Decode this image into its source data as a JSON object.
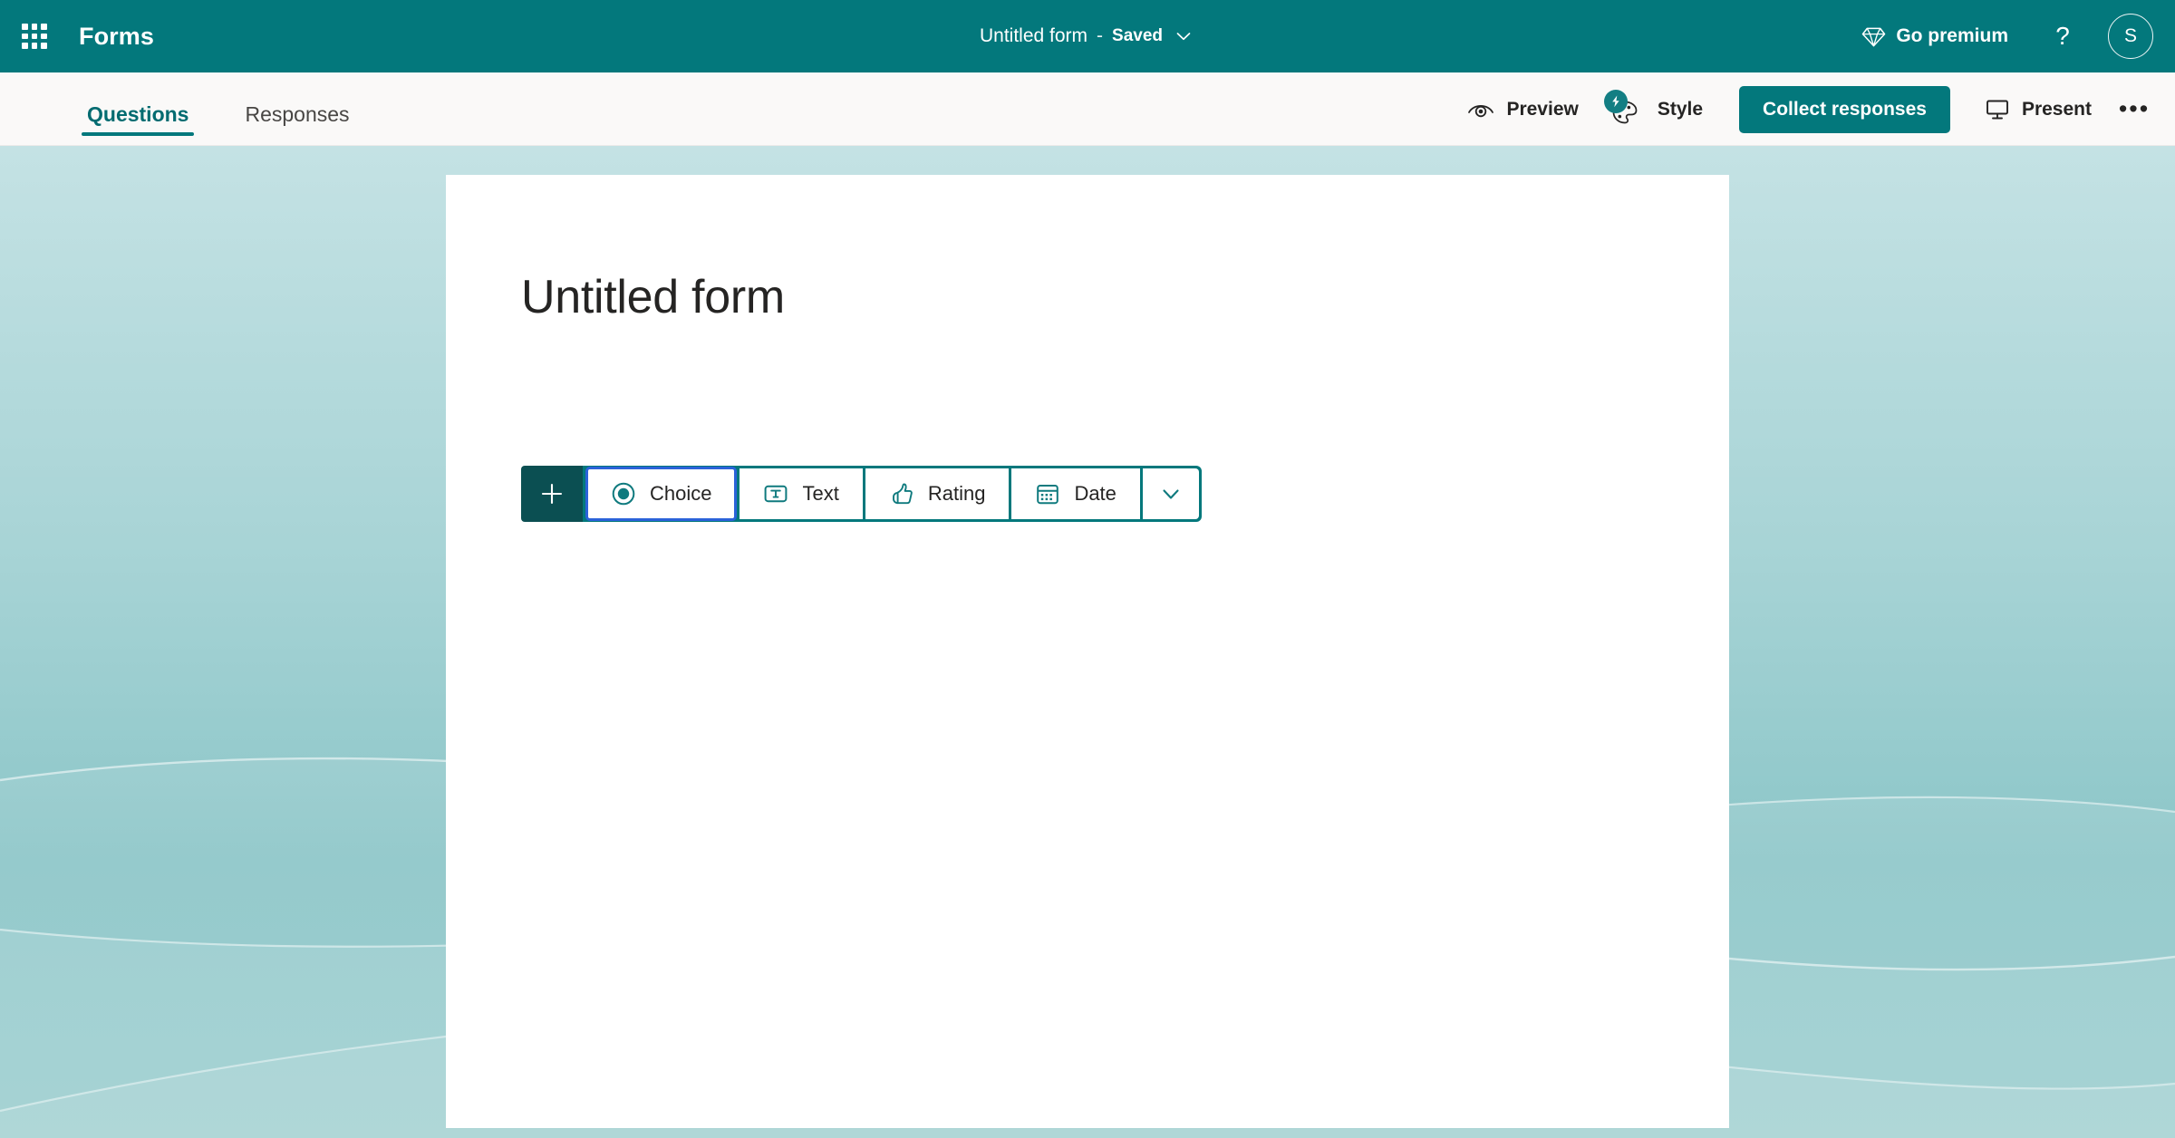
{
  "app": {
    "name": "Forms",
    "brand_color": "#03787c",
    "dark_teal": "#0b4f52",
    "focus_ring_color": "#2b62d9"
  },
  "topbar": {
    "waffle_label": "app-launcher",
    "doc_title": "Untitled form",
    "doc_separator": "-",
    "save_status": "Saved",
    "title_chevron": "chevron-down",
    "premium_label": "Go premium",
    "help_label": "?",
    "avatar_initial": "S"
  },
  "commandbar": {
    "tabs": [
      {
        "label": "Questions",
        "active": true
      },
      {
        "label": "Responses",
        "active": false
      }
    ],
    "preview_label": "Preview",
    "style_label": "Style",
    "collect_label": "Collect responses",
    "present_label": "Present",
    "more_label": "•••"
  },
  "form": {
    "title": "Untitled form"
  },
  "question_toolbar": {
    "add_label": "+",
    "types": [
      {
        "label": "Choice",
        "icon": "radio-button-icon",
        "focused": true
      },
      {
        "label": "Text",
        "icon": "text-box-icon",
        "focused": false
      },
      {
        "label": "Rating",
        "icon": "thumbs-up-icon",
        "focused": false
      },
      {
        "label": "Date",
        "icon": "calendar-icon",
        "focused": false
      }
    ],
    "more_types_icon": "chevron-down-icon"
  }
}
